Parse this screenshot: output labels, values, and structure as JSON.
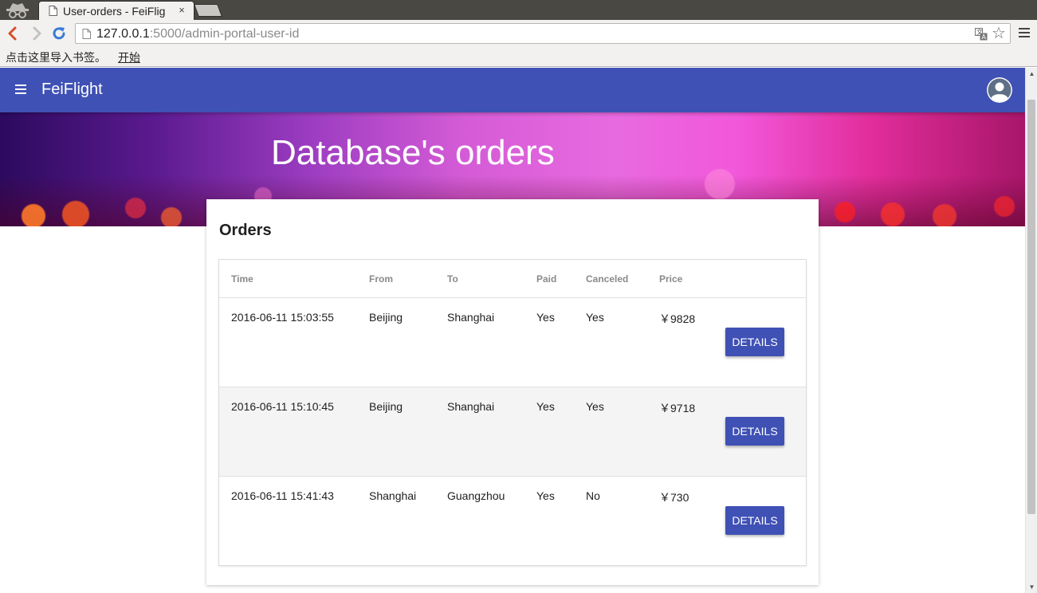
{
  "browser": {
    "tab_title": "User-orders - FeiFlig",
    "tab_close": "×",
    "url_host": "127.0.0.1",
    "url_rest": ":5000/admin-portal-user-id",
    "star_glyph": "☆",
    "bookmarks_prompt": "点击这里导入书签。",
    "bookmarks_link": "开始"
  },
  "app": {
    "brand": "FeiFlight",
    "accent_color": "#3f51b5"
  },
  "hero": {
    "title": "Database's orders"
  },
  "orders": {
    "title": "Orders",
    "columns": {
      "time": "Time",
      "from": "From",
      "to": "To",
      "paid": "Paid",
      "canceled": "Canceled",
      "price": "Price"
    },
    "rows": [
      {
        "time": "2016-06-11 15:03:55",
        "from": "Beijing",
        "to": "Shanghai",
        "paid": "Yes",
        "canceled": "Yes",
        "price": "￥9828",
        "action": "DETAILS"
      },
      {
        "time": "2016-06-11 15:10:45",
        "from": "Beijing",
        "to": "Shanghai",
        "paid": "Yes",
        "canceled": "Yes",
        "price": "￥9718",
        "action": "DETAILS"
      },
      {
        "time": "2016-06-11 15:41:43",
        "from": "Shanghai",
        "to": "Guangzhou",
        "paid": "Yes",
        "canceled": "No",
        "price": "￥730",
        "action": "DETAILS"
      }
    ]
  }
}
